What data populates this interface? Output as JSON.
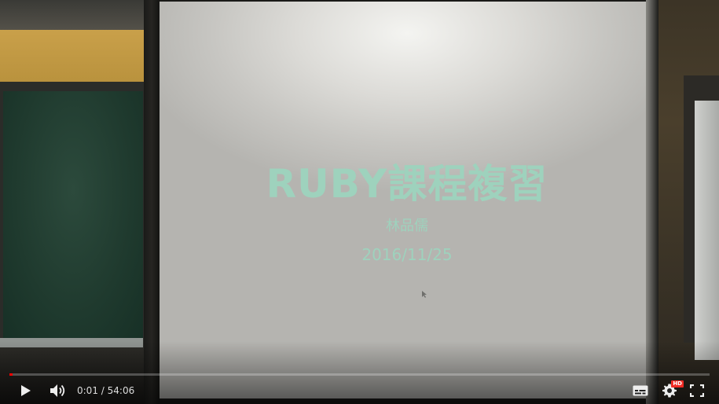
{
  "slide": {
    "title": "RUBY課程複習",
    "author": "林品儒",
    "date": "2016/11/25"
  },
  "player": {
    "played_fraction": 0.0003,
    "current_time": "0:01",
    "separator": "/",
    "duration": "54:06",
    "hd_badge": "HD",
    "accent_color": "#ff0000",
    "icons": [
      "play-icon",
      "volume-icon",
      "subtitles-icon",
      "settings-icon",
      "fullscreen-icon"
    ]
  }
}
